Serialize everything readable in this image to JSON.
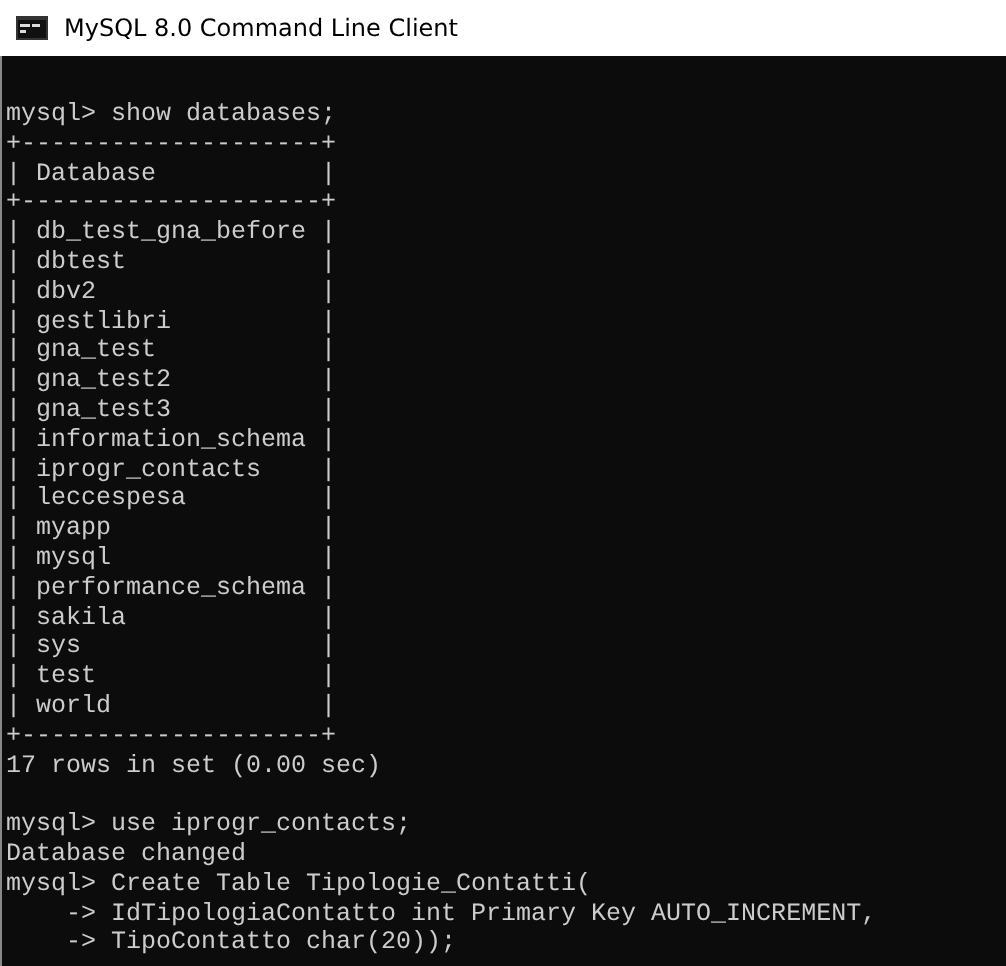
{
  "window": {
    "title": "MySQL 8.0 Command Line Client"
  },
  "console": {
    "blocks": [
      [
        "mysql> show databases;",
        "+--------------------+",
        "| Database           |",
        "+--------------------+",
        "| db_test_gna_before |",
        "| dbtest             |",
        "| dbv2               |",
        "| gestlibri          |",
        "| gna_test           |",
        "| gna_test2          |",
        "| gna_test3          |",
        "| information_schema |",
        "| iprogr_contacts    |",
        "| leccespesa         |",
        "| myapp              |",
        "| mysql              |",
        "| performance_schema |",
        "| sakila             |",
        "| sys                |",
        "| test               |",
        "| world              |",
        "+--------------------+",
        "17 rows in set (0.00 sec)"
      ],
      [
        "mysql> use iprogr_contacts;",
        "Database changed",
        "mysql> Create Table Tipologie_Contatti(",
        "    -> IdTipologiaContatto int Primary Key AUTO_INCREMENT,",
        "    -> TipoContatto char(20));"
      ]
    ]
  }
}
